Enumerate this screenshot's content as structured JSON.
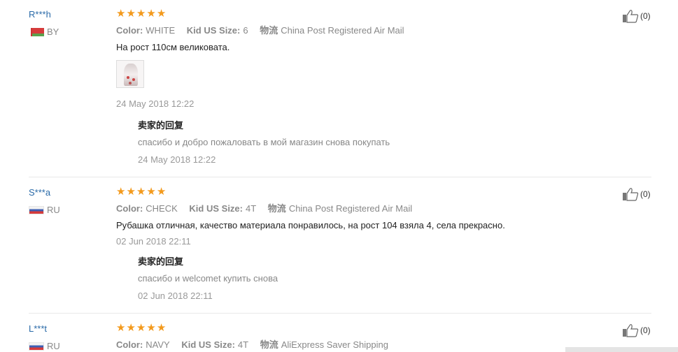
{
  "reviews": [
    {
      "user": "R***h",
      "country": "BY",
      "stars": 5,
      "color_label": "Color:",
      "color_value": "WHITE",
      "size_label": "Kid US Size:",
      "size_value": "6",
      "ship_label": "物流",
      "ship_value": "China Post Registered Air Mail",
      "text": "На рост 110см великовата.",
      "date": "24 May 2018 12:22",
      "reply_title": "卖家的回复",
      "reply_text": "спасибо и добро пожаловать в мой магазин снова покупать",
      "reply_date": "24 May 2018 12:22",
      "likes": "(0)"
    },
    {
      "user": "S***a",
      "country": "RU",
      "stars": 5,
      "color_label": "Color:",
      "color_value": "CHECK",
      "size_label": "Kid US Size:",
      "size_value": "4T",
      "ship_label": "物流",
      "ship_value": "China Post Registered Air Mail",
      "text": "Рубашка отличная, качество материала понравилось, на рост 104 взяла 4, села прекрасно.",
      "date": "02 Jun 2018 22:11",
      "reply_title": "卖家的回复",
      "reply_text": "спасибо и welcomet купить снова",
      "reply_date": "02 Jun 2018 22:11",
      "likes": "(0)"
    },
    {
      "user": "L***t",
      "country": "RU",
      "stars": 5,
      "color_label": "Color:",
      "color_value": "NAVY",
      "size_label": "Kid US Size:",
      "size_value": "4T",
      "ship_label": "物流",
      "ship_value": "AliExpress Saver Shipping",
      "likes": "(0)"
    }
  ],
  "colors": {
    "username": "#2a6aa8",
    "star": "#f39a1d",
    "muted": "#888888"
  }
}
